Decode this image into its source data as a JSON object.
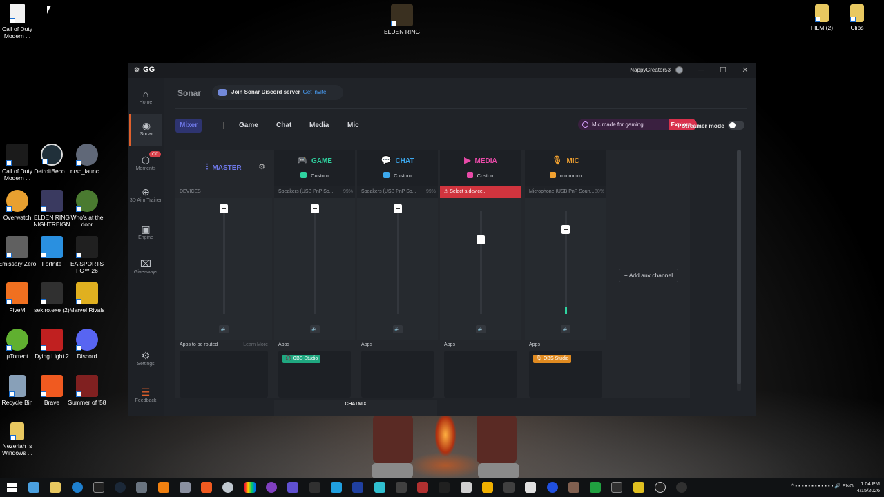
{
  "desktop": {
    "icons": [
      {
        "label": "Call of Duty Modern ...",
        "color": "#f2f2f2"
      },
      {
        "label": "ELDEN RING",
        "color": "#3a3020"
      },
      {
        "label": "FILM (2)",
        "color": "#e8c860"
      },
      {
        "label": "Clips",
        "color": "#e8c860"
      },
      {
        "label": "Call of Duty Modern ...",
        "color": "#1b1b1b"
      },
      {
        "label": "DetroitBeco...",
        "color": "#20303a"
      },
      {
        "label": "nrsc_launc...",
        "color": "#606878"
      },
      {
        "label": "Overwatch",
        "color": "#e8a030"
      },
      {
        "label": "ELDEN RING NIGHTREIGN",
        "color": "#3a3a60"
      },
      {
        "label": "Who's at the door",
        "color": "#4a7a30"
      },
      {
        "label": "Emissary Zero",
        "color": "#606060"
      },
      {
        "label": "Fortnite",
        "color": "#2a90e0"
      },
      {
        "label": "EA SPORTS FC™ 26",
        "color": "#202020"
      },
      {
        "label": "FiveM",
        "color": "#f07020"
      },
      {
        "label": "sekiro.exe (2)",
        "color": "#303030"
      },
      {
        "label": "Marvel Rivals",
        "color": "#e0b020"
      },
      {
        "label": "µTorrent",
        "color": "#60b030"
      },
      {
        "label": "Dying Light 2",
        "color": "#c02020"
      },
      {
        "label": "Discord",
        "color": "#5865f2"
      },
      {
        "label": "Recycle Bin",
        "color": "#88a0b8"
      },
      {
        "label": "Brave",
        "color": "#f05a20"
      },
      {
        "label": "Summer of '58",
        "color": "#802020"
      },
      {
        "label": "Nezeriah_s Windows ...",
        "color": "#e8c860"
      }
    ]
  },
  "window": {
    "logo": "GG",
    "logo_icon": "steelseries-icon",
    "username": "NappyCreator53",
    "minimize": "─",
    "maximize": "☐",
    "close": "✕"
  },
  "sidebar": {
    "items": [
      {
        "label": "Home",
        "icon": "⌂"
      },
      {
        "label": "Sonar",
        "icon": "◉"
      },
      {
        "label": "Moments",
        "icon": "⬡",
        "badge": "Off"
      },
      {
        "label": "3D Aim Trainer",
        "icon": "⊕"
      },
      {
        "label": "Engine",
        "icon": "▣"
      },
      {
        "label": "Giveaways",
        "icon": "⌧"
      },
      {
        "label": "Settings",
        "icon": "⚙"
      },
      {
        "label": "Feedback",
        "icon": "☰"
      }
    ]
  },
  "sonar": {
    "title": "Sonar",
    "discord_text": "Join Sonar Discord server",
    "discord_link": "Get invite",
    "tabs": [
      "Mixer",
      "Game",
      "Chat",
      "Media",
      "Mic"
    ],
    "mic_promo": "Mic made for gaming",
    "mic_promo_cta": "Explore",
    "streamer_mode": "Streamer mode",
    "add_aux": "+ Add aux channel",
    "chatmix": "CHATMIX"
  },
  "channels": {
    "master": {
      "title": "MASTER",
      "devices_label": "DEVICES",
      "apps_label": "Apps to be routed",
      "learn_more": "Learn More",
      "speaker_icon": "🔈"
    },
    "game": {
      "title": "GAME",
      "preset": "Custom",
      "device": "Speakers (USB PnP So...",
      "pct": "99%",
      "apps_label": "Apps",
      "app": "OBS Studio",
      "color": "#2fd3a0",
      "level": 0.95
    },
    "chat": {
      "title": "CHAT",
      "preset": "Custom",
      "device": "Speakers (USB PnP So...",
      "pct": "99%",
      "apps_label": "Apps",
      "color": "#3ca8ee",
      "level": 0.95
    },
    "media": {
      "title": "MEDIA",
      "preset": "Custom",
      "device": "Select a device...",
      "apps_label": "Apps",
      "color": "#e84aa8",
      "level": 0.7
    },
    "mic": {
      "title": "MIC",
      "preset": "mmmmm",
      "device": "Microphone (USB PnP Soun...",
      "pct": "80%",
      "apps_label": "Apps",
      "app": "OBS Studio",
      "color": "#f0a030",
      "level": 0.8
    }
  },
  "taskbar": {
    "lang": "ENG",
    "time": "1:04 PM",
    "date": "4/15/2026"
  }
}
